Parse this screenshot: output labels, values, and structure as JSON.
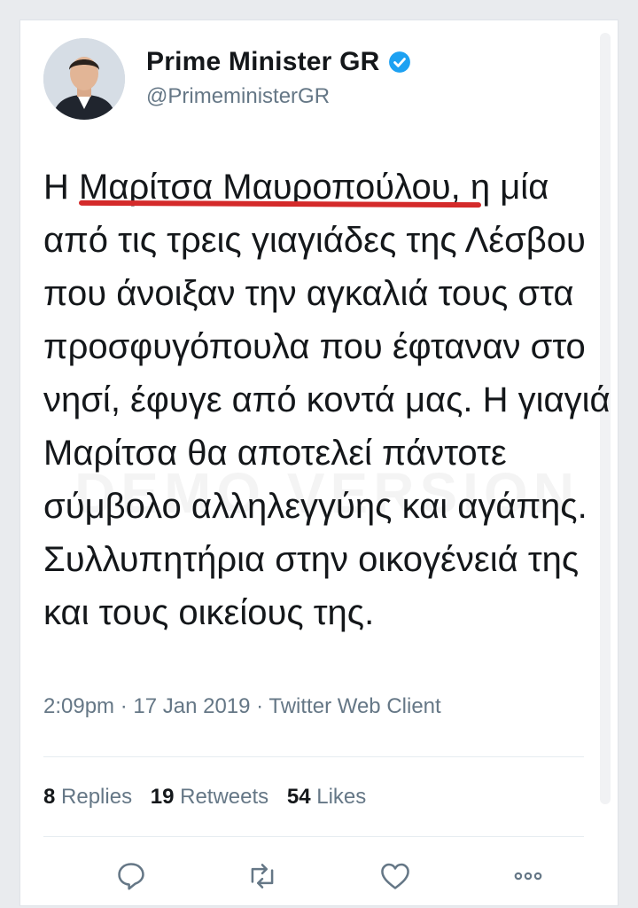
{
  "tweet": {
    "display_name": "Prime Minister GR",
    "handle": "@PrimeministerGR",
    "verified_icon": "verified-badge-icon",
    "text": "Η Μαρίτσα Μαυροπούλου, η μία από τις τρεις γιαγιάδες της Λέσβου που άνοιξαν την αγκαλιά τους στα προσφυγόπουλα που έφταναν στο νησί, έφυγε από κοντά μας. Η γιαγιά Μαρίτσα θα αποτελεί πάντοτε σύμβολο αλληλεγγύης και αγάπης. Συλλυπητήρια στην οικογένειά της και τους οικείους της.",
    "timestamp": "2:09pm · 17 Jan 2019 · Twitter Web Client",
    "watermark": "DEMO VERSION"
  },
  "stats": {
    "replies_count": "8",
    "replies_label": "Replies",
    "retweets_count": "19",
    "retweets_label": "Retweets",
    "likes_count": "54",
    "likes_label": "Likes"
  },
  "actions": {
    "reply_icon": "reply-icon",
    "retweet_icon": "retweet-icon",
    "like_icon": "heart-icon",
    "more_icon": "more-icon"
  },
  "colors": {
    "accent": "#1da1f2",
    "annotation": "#d42a2a",
    "muted": "#657786",
    "text": "#14171a"
  }
}
